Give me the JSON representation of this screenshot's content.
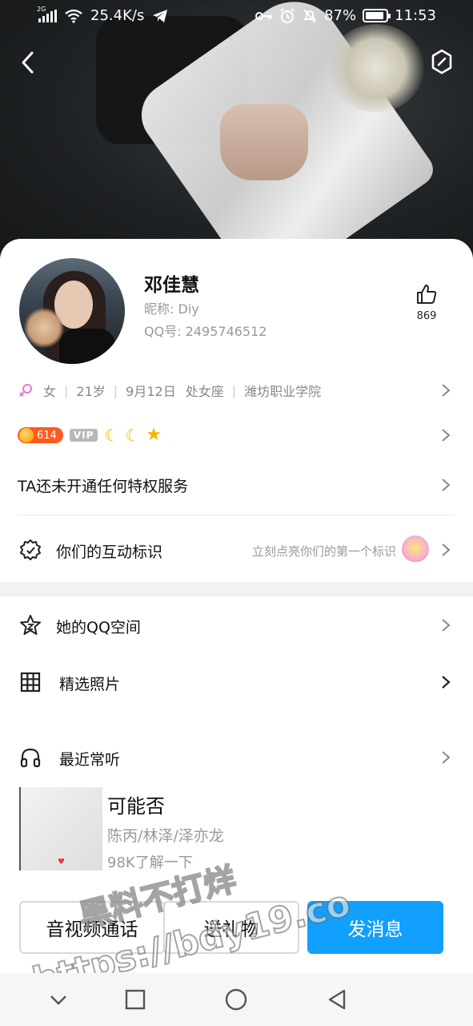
{
  "status_bar": {
    "network_tag": "2G",
    "speed": "25.4K/s",
    "battery": "87%",
    "time": "11:53"
  },
  "profile": {
    "name": "邓佳慧",
    "nickname": "昵称:  Diy",
    "qq_number": "QQ号:  2495746512",
    "likes": "869",
    "gender": "女",
    "age": "21岁",
    "birthday": "9月12日",
    "zodiac": "处女座",
    "school": "潍坊职业学院"
  },
  "badges": {
    "level": "614",
    "vip": "VIP"
  },
  "privilege_text": "TA还未开通任何特权服务",
  "interaction": {
    "label": "你们的互动标识",
    "hint": "立刻点亮你们的第一个标识"
  },
  "menu": {
    "qzone": "她的QQ空间",
    "photos": "精选照片",
    "recent_music": "最近常听"
  },
  "song": {
    "title": "可能否",
    "artist": "陈丙/林泽/泽亦龙",
    "plays": "98K了解一下"
  },
  "actions": {
    "call": "音视频通话",
    "gift": "送礼物",
    "message": "发消息"
  },
  "watermark": {
    "line1": "黑料不打烊",
    "line2": "https://bdy19.co"
  },
  "colors": {
    "accent": "#12a0ff",
    "level_badge": "#ff5a1e"
  }
}
